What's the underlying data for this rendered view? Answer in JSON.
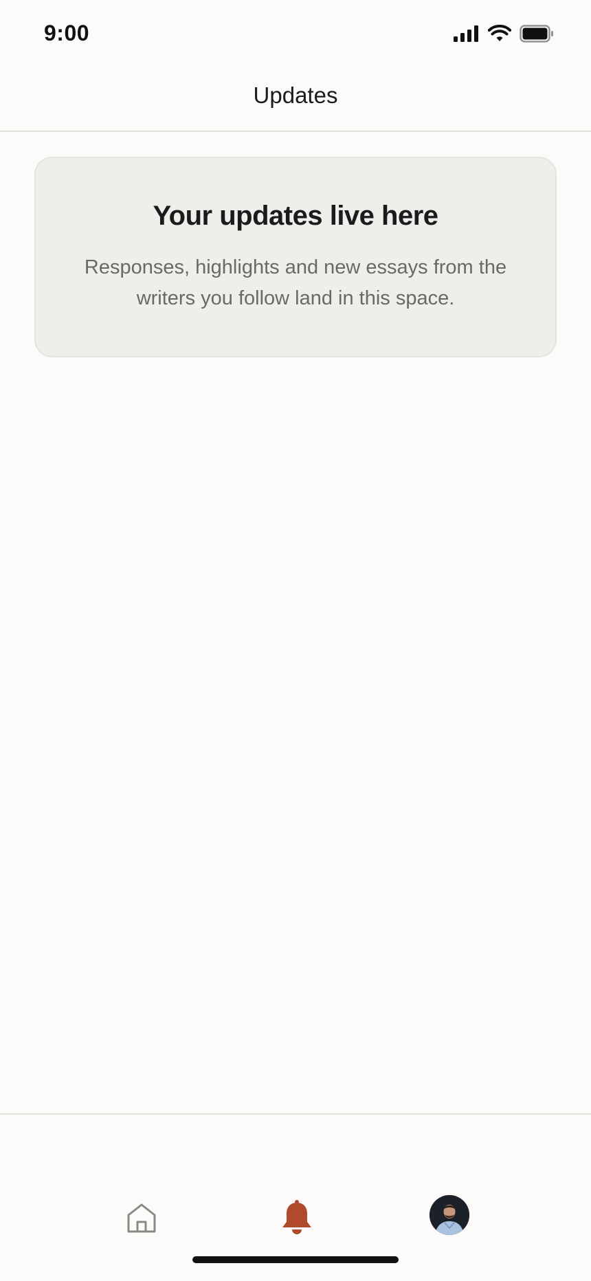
{
  "status_bar": {
    "time": "9:00",
    "icons": [
      "cellular-signal-icon",
      "wifi-icon",
      "battery-icon"
    ]
  },
  "header": {
    "title": "Updates"
  },
  "empty_state": {
    "title": "Your updates live here",
    "body": "Responses, highlights and new essays from the writers you follow land in this space."
  },
  "tab_bar": {
    "tabs": [
      {
        "name": "home",
        "icon": "home-icon",
        "selected": false
      },
      {
        "name": "updates",
        "icon": "bell-icon",
        "selected": true
      },
      {
        "name": "profile",
        "icon": "avatar",
        "selected": false
      }
    ]
  },
  "colors": {
    "background": "#fcfbf9",
    "card_background": "#efeeeb",
    "accent": "#b04a2c",
    "muted_text": "#6b6965",
    "inactive_icon": "#8b8985"
  }
}
